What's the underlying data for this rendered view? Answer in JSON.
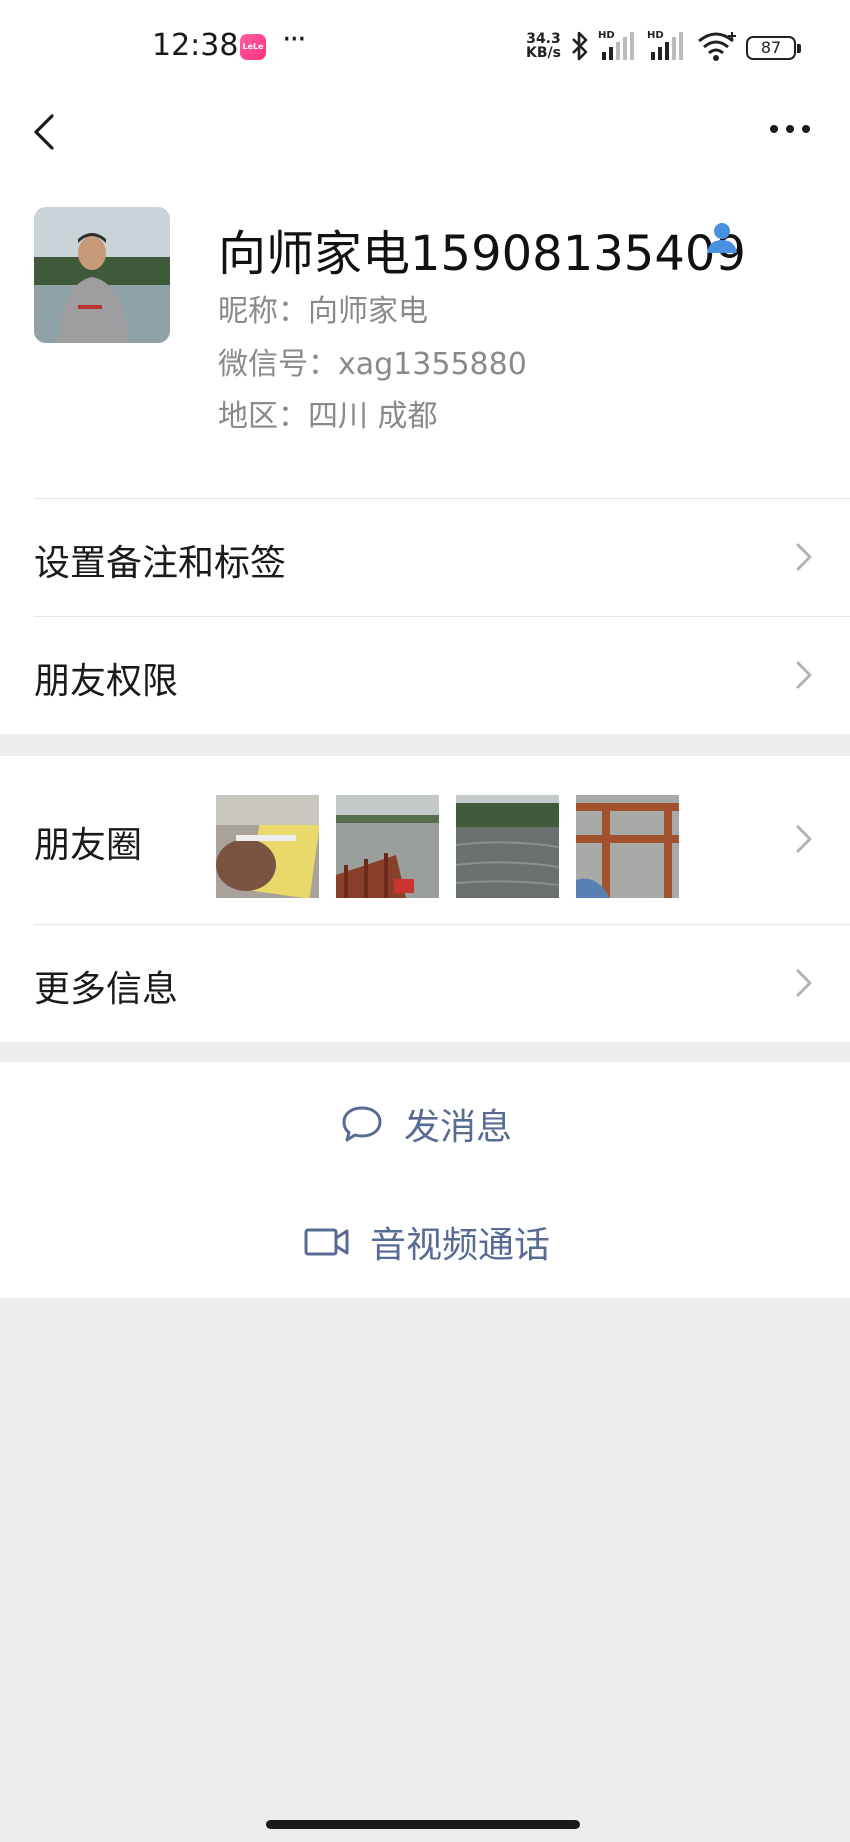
{
  "status_bar": {
    "time": "12:38",
    "app_icon_text": "LeLe",
    "more": "···",
    "net_speed_value": "34.3",
    "net_speed_unit": "KB/s",
    "signal_label_1": "HD",
    "signal_label_2": "HD",
    "battery": "87"
  },
  "profile": {
    "display_name": "向师家电15908135409",
    "nickname": "昵称：向师家电",
    "wechat_id": "微信号：xag1355880",
    "region": "地区：四川  成都",
    "badge_icon": "contact-person-icon"
  },
  "menu": {
    "remark_tags": "设置备注和标签",
    "friend_permissions": "朋友权限",
    "moments": "朋友圈",
    "more_info": "更多信息"
  },
  "actions": {
    "send_message": "发消息",
    "av_call": "音视频通话"
  },
  "colors": {
    "link_blue": "#576b95",
    "background": "#ededed",
    "badge_blue": "#4a90e2"
  }
}
